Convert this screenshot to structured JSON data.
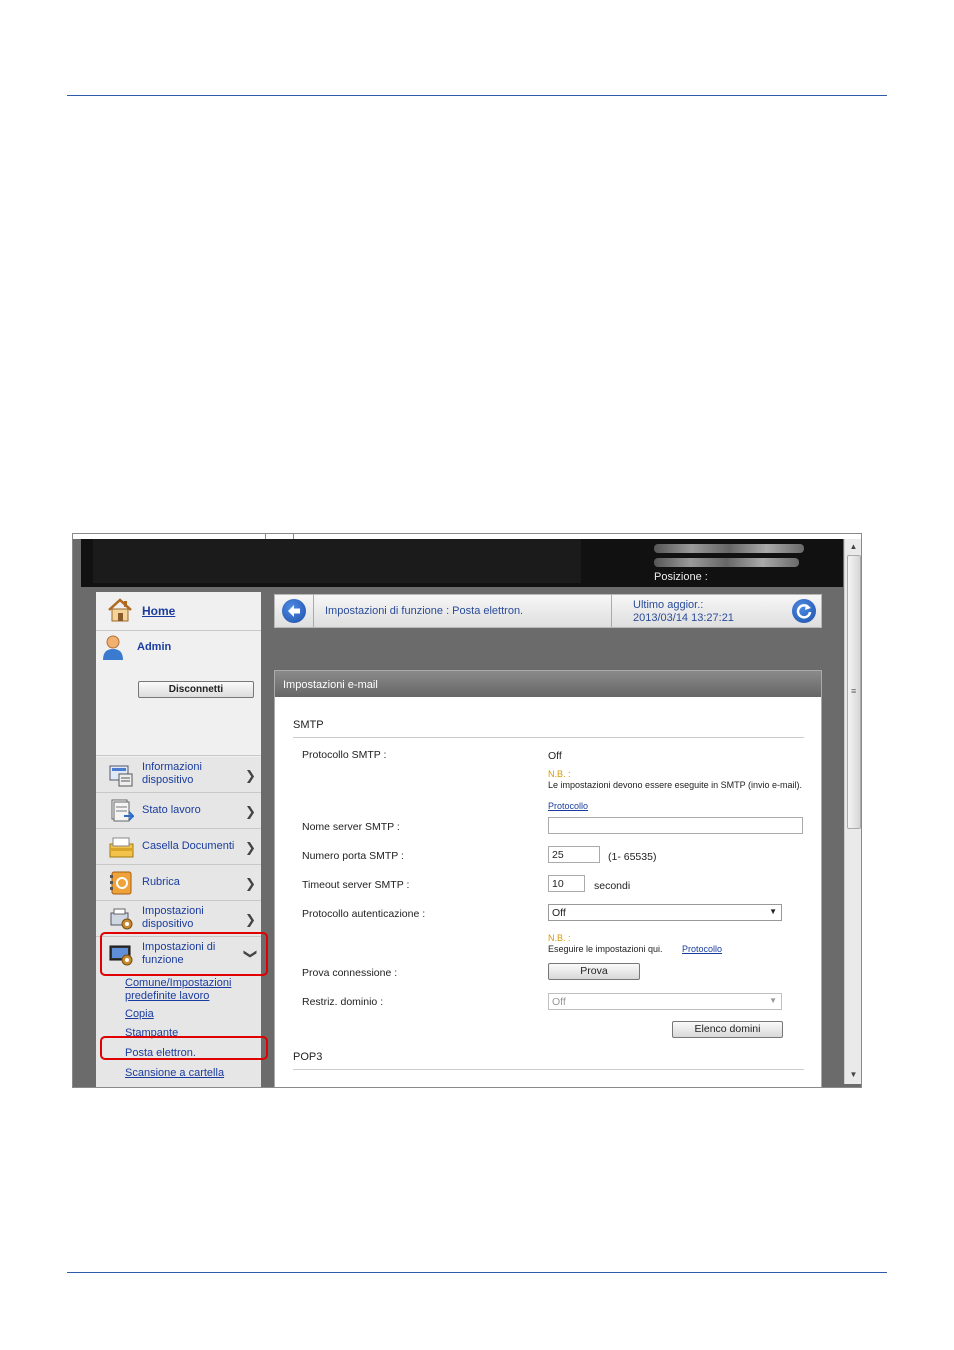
{
  "header": {
    "position_label": "Posizione :"
  },
  "left_menu": {
    "home": "Home",
    "user": "Admin",
    "logout": "Disconnetti",
    "items": [
      {
        "label": "Informazioni dispositivo",
        "icon": "device-info-icon"
      },
      {
        "label": "Stato lavoro",
        "icon": "job-status-icon"
      },
      {
        "label": "Casella Documenti",
        "icon": "document-box-icon"
      },
      {
        "label": "Rubrica",
        "icon": "address-book-icon"
      },
      {
        "label": "Impostazioni dispositivo",
        "icon": "device-settings-icon"
      },
      {
        "label": "Impostazioni di funzione",
        "icon": "function-settings-icon"
      }
    ],
    "sub_items": [
      "Comune/Impostazioni predefinite lavoro",
      "Copia",
      "Stampante",
      "Posta elettron.",
      "Scansione a cartella"
    ]
  },
  "breadcrumb": {
    "text": "Impostazioni di funzione : Posta elettron.",
    "updated_label": "Ultimo aggior.:",
    "updated_value": "2013/03/14 13:27:21"
  },
  "panel": {
    "title": "Impostazioni e-mail",
    "smtp_section": "SMTP",
    "pop3_section": "POP3",
    "protocol_label": "Protocollo SMTP :",
    "protocol_value": "Off",
    "note_label": "N.B. :",
    "note1_text": "Le impostazioni devono essere eseguite in SMTP (invio e-mail).",
    "note_link": "Protocollo",
    "server_label": "Nome server SMTP :",
    "server_value": "",
    "port_label": "Numero porta SMTP :",
    "port_value": "25",
    "port_range": "(1- 65535)",
    "timeout_label": "Timeout server SMTP :",
    "timeout_value": "10",
    "timeout_unit": "secondi",
    "auth_label": "Protocollo autenticazione :",
    "auth_value": "Off",
    "note2_text": "Eseguire le impostazioni qui.",
    "test_label": "Prova connessione :",
    "test_button": "Prova",
    "domain_label": "Restriz. dominio :",
    "domain_value": "Off",
    "domain_button": "Elenco domini"
  },
  "colors": {
    "link": "#1a3c9e",
    "highlight": "#e00000",
    "note": "#d79a00",
    "rule": "#2d5ca8"
  }
}
